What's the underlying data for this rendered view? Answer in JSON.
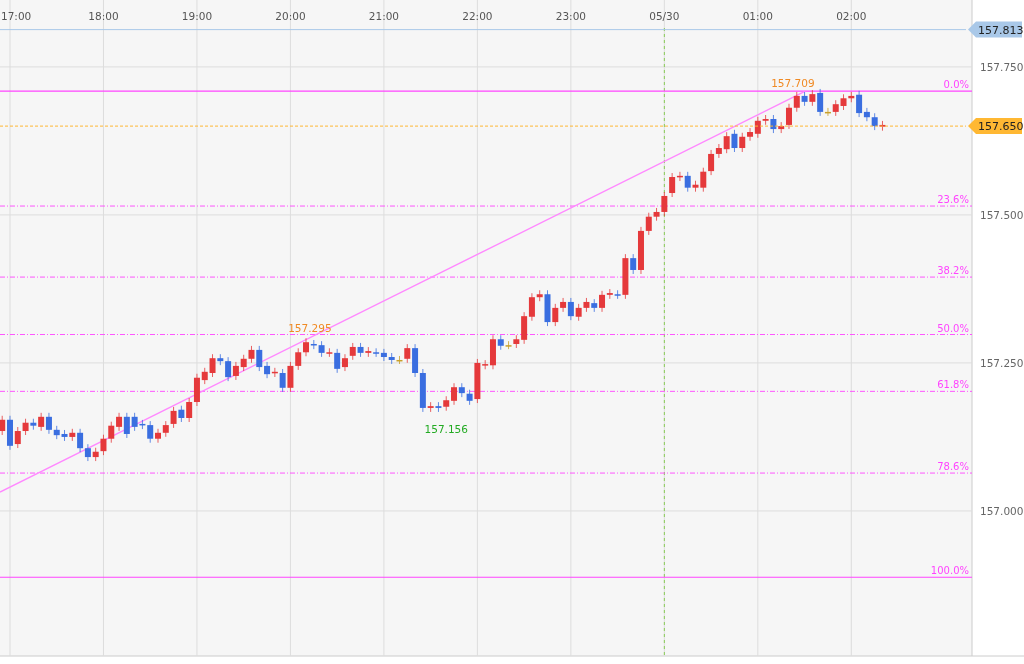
{
  "chart": {
    "time_labels": [
      "17:00",
      "18:00",
      "19:00",
      "20:00",
      "21:00",
      "22:00",
      "23:00",
      "05/30",
      "01:00",
      "02:00"
    ],
    "price_labels": [
      "157.750",
      "157.500",
      "157.250",
      "157.000"
    ],
    "price_tags": [
      {
        "label": "157.813",
        "color": "#a9c8e8"
      },
      {
        "label": "157.650",
        "color": "#ffb833"
      }
    ],
    "fib_levels": [
      {
        "label": "0.0%"
      },
      {
        "label": "23.6%"
      },
      {
        "label": "38.2%"
      },
      {
        "label": "50.0%"
      },
      {
        "label": "61.8%"
      },
      {
        "label": "78.6%"
      },
      {
        "label": "100.0%"
      }
    ],
    "point_labels": [
      {
        "label": "157.709",
        "color": "#f08a24"
      },
      {
        "label": "157.295",
        "color": "#f08a24"
      },
      {
        "label": "157.156",
        "color": "#22aa22"
      }
    ]
  }
}
